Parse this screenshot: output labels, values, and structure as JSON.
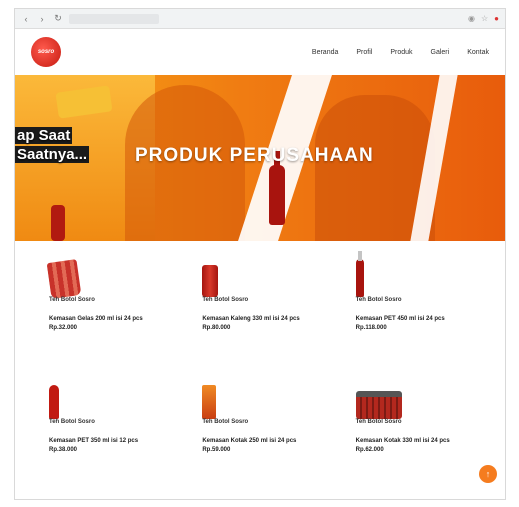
{
  "nav": {
    "logo_text": "sosro",
    "menu": [
      "Beranda",
      "Profil",
      "Produk",
      "Galeri",
      "Kontak"
    ]
  },
  "hero": {
    "slogan_line1": "ap Saat",
    "slogan_line2": "Saatnya...",
    "title": "PRODUK PERUSAHAAN"
  },
  "products": [
    {
      "category": "Teh Botol Sosro",
      "name": "Kemasan Gelas 200 ml isi 24 pcs Rp.32.000",
      "image": "cup"
    },
    {
      "category": "Teh Botol Sosro",
      "name": "Kemasan Kaleng 330 ml isi 24 pcs Rp.80.000",
      "image": "can"
    },
    {
      "category": "Teh Botol Sosro",
      "name": "Kemasan PET 450 ml isi 24 pcs Rp.118.000",
      "image": "bottle"
    },
    {
      "category": "Teh Botol Sosro",
      "name": "Kemasan PET 350 ml isi 12 pcs Rp.38.000",
      "image": "bottle-small"
    },
    {
      "category": "Teh Botol Sosro",
      "name": "Kemasan Kotak 250 ml isi 24 pcs Rp.59.000",
      "image": "box"
    },
    {
      "category": "Teh Botol Sosro",
      "name": "Kemasan Kotak 330 ml isi 24 pcs Rp.62.000",
      "image": "pack"
    }
  ],
  "fab_icon": "arrow-up-icon"
}
